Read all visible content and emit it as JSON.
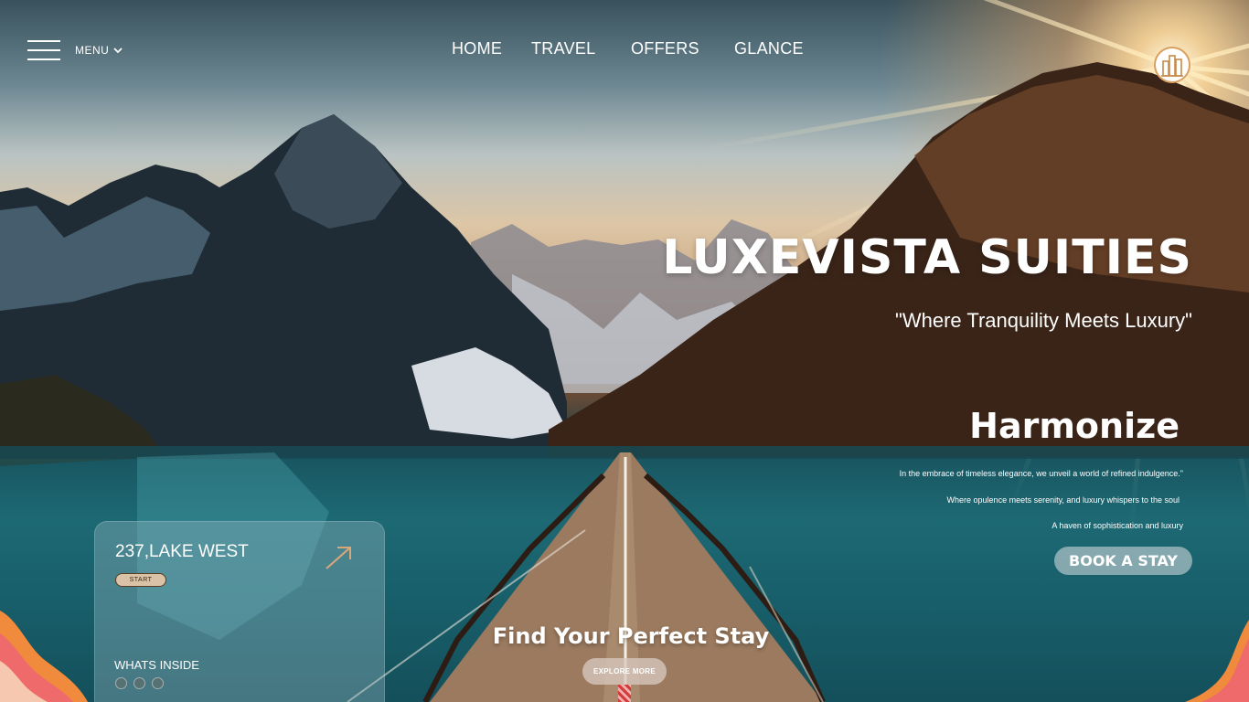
{
  "header": {
    "menu_label": "MENU",
    "nav": [
      "HOME",
      "TRAVEL",
      "OFFERS",
      "GLANCE"
    ]
  },
  "hero": {
    "title": "LUXEVISTA SUITIES",
    "tagline": "\"Where Tranquility Meets Luxury\""
  },
  "feature": {
    "heading": "Harmonize",
    "lines": [
      "In the embrace of timeless elegance, we unveil a world of refined indulgence.\"",
      "Where opulence meets serenity, and luxury whispers to the soul",
      "A haven of sophistication and luxury"
    ],
    "cta_label": "BOOK A STAY"
  },
  "location_card": {
    "address": "237,LAKE WEST",
    "start_label": "START",
    "inside_label": "WHATS INSIDE",
    "amenity_icons": [
      "amenity-icon-1",
      "amenity-icon-2",
      "amenity-icon-3"
    ]
  },
  "bottom": {
    "heading": "Find Your Perfect Stay",
    "explore_label": "EXPLORE MORE"
  },
  "colors": {
    "sun": "#ffd69a",
    "lake": "#1f6f79",
    "accent_tan": "#d9c2a6",
    "wave_orange": "#f08a3c",
    "wave_pink": "#ef6a6a"
  }
}
